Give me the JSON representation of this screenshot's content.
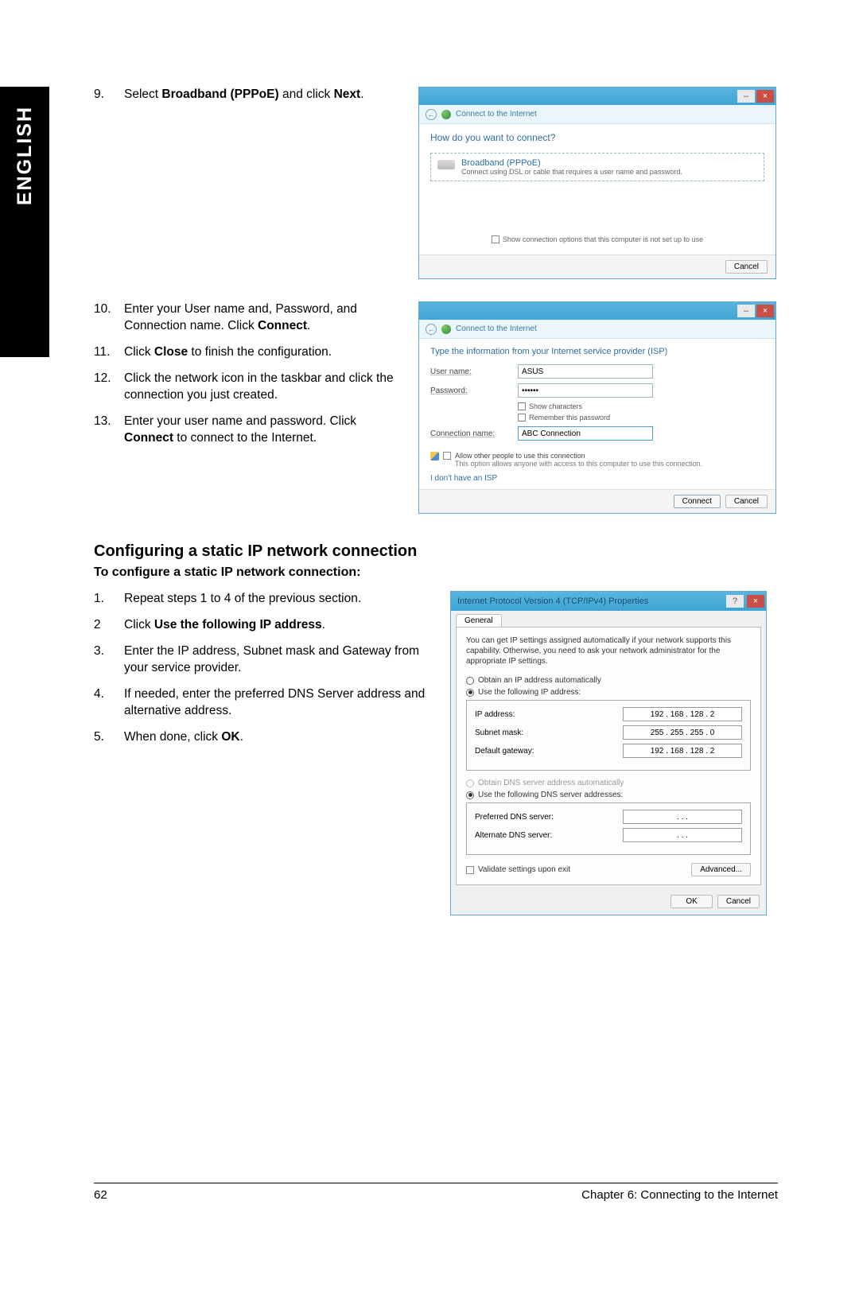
{
  "sidebar": {
    "language": "ENGLISH"
  },
  "steps_a": {
    "s9_num": "9.",
    "s9_a": "Select ",
    "s9_b": "Broadband (PPPoE)",
    "s9_c": " and click ",
    "s9_d": "Next",
    "s9_e": "."
  },
  "dialog1": {
    "crumb": "Connect to the Internet",
    "question": "How do you want to connect?",
    "pppoe_title": "Broadband (PPPoE)",
    "pppoe_desc": "Connect using DSL or cable that requires a user name and password.",
    "show_opts": "Show connection options that this computer is not set up to use",
    "cancel": "Cancel"
  },
  "steps_b": {
    "s10_num": "10.",
    "s10_a": "Enter your User name and, Password, and Connection name. Click ",
    "s10_b": "Connect",
    "s10_c": ".",
    "s11_num": "11.",
    "s11_a": "Click ",
    "s11_b": "Close",
    "s11_c": " to finish the configuration.",
    "s12_num": "12.",
    "s12": "Click the network icon in the taskbar and click the connection you just created.",
    "s13_num": "13.",
    "s13_a": "Enter your user name and password. Click ",
    "s13_b": "Connect",
    "s13_c": " to connect to the Internet."
  },
  "dialog2": {
    "crumb": "Connect to the Internet",
    "head": "Type the information from your Internet service provider (ISP)",
    "user_lbl": "User name:",
    "user_val": "ASUS",
    "pass_lbl": "Password:",
    "pass_val": "••••••",
    "show_chars": "Show characters",
    "remember": "Remember this password",
    "conn_lbl": "Connection name:",
    "conn_val": "ABC Connection",
    "allow_a": "Allow other people to use this connection",
    "allow_b": "This option allows anyone with access to this computer to use this connection.",
    "noisp": "I don't have an ISP",
    "connect": "Connect",
    "cancel": "Cancel"
  },
  "section": {
    "h": "Configuring a static IP network connection",
    "sub": "To configure a static IP network connection:"
  },
  "steps_c": {
    "s1_num": "1.",
    "s1": "Repeat steps 1 to 4 of the previous section.",
    "s2_num": "2",
    "s2_a": "Click ",
    "s2_b": "Use the following IP address",
    "s2_c": ".",
    "s3_num": "3.",
    "s3": "Enter the IP address, Subnet mask and Gateway from your service provider.",
    "s4_num": "4.",
    "s4": "If needed, enter the preferred DNS Server address and alternative address.",
    "s5_num": "5.",
    "s5_a": "When done, click ",
    "s5_b": "OK",
    "s5_c": "."
  },
  "ipv4": {
    "title": "Internet Protocol Version 4 (TCP/IPv4) Properties",
    "tab": "General",
    "desc": "You can get IP settings assigned automatically if your network supports this capability. Otherwise, you need to ask your network administrator for the appropriate IP settings.",
    "r_auto_ip": "Obtain an IP address automatically",
    "r_use_ip": "Use the following IP address:",
    "ip_lbl": "IP address:",
    "ip_val": "192 . 168 . 128 .   2",
    "mask_lbl": "Subnet mask:",
    "mask_val": "255 . 255 . 255 .   0",
    "gw_lbl": "Default gateway:",
    "gw_val": "192 . 168 . 128 .   2",
    "r_auto_dns": "Obtain DNS server address automatically",
    "r_use_dns": "Use the following DNS server addresses:",
    "pdns_lbl": "Preferred DNS server:",
    "adns_lbl": "Alternate DNS server:",
    "empty_ip": ".       .       .",
    "validate": "Validate settings upon exit",
    "advanced": "Advanced...",
    "ok": "OK",
    "cancel": "Cancel"
  },
  "footer": {
    "page": "62",
    "chapter": "Chapter 6: Connecting to the Internet"
  }
}
